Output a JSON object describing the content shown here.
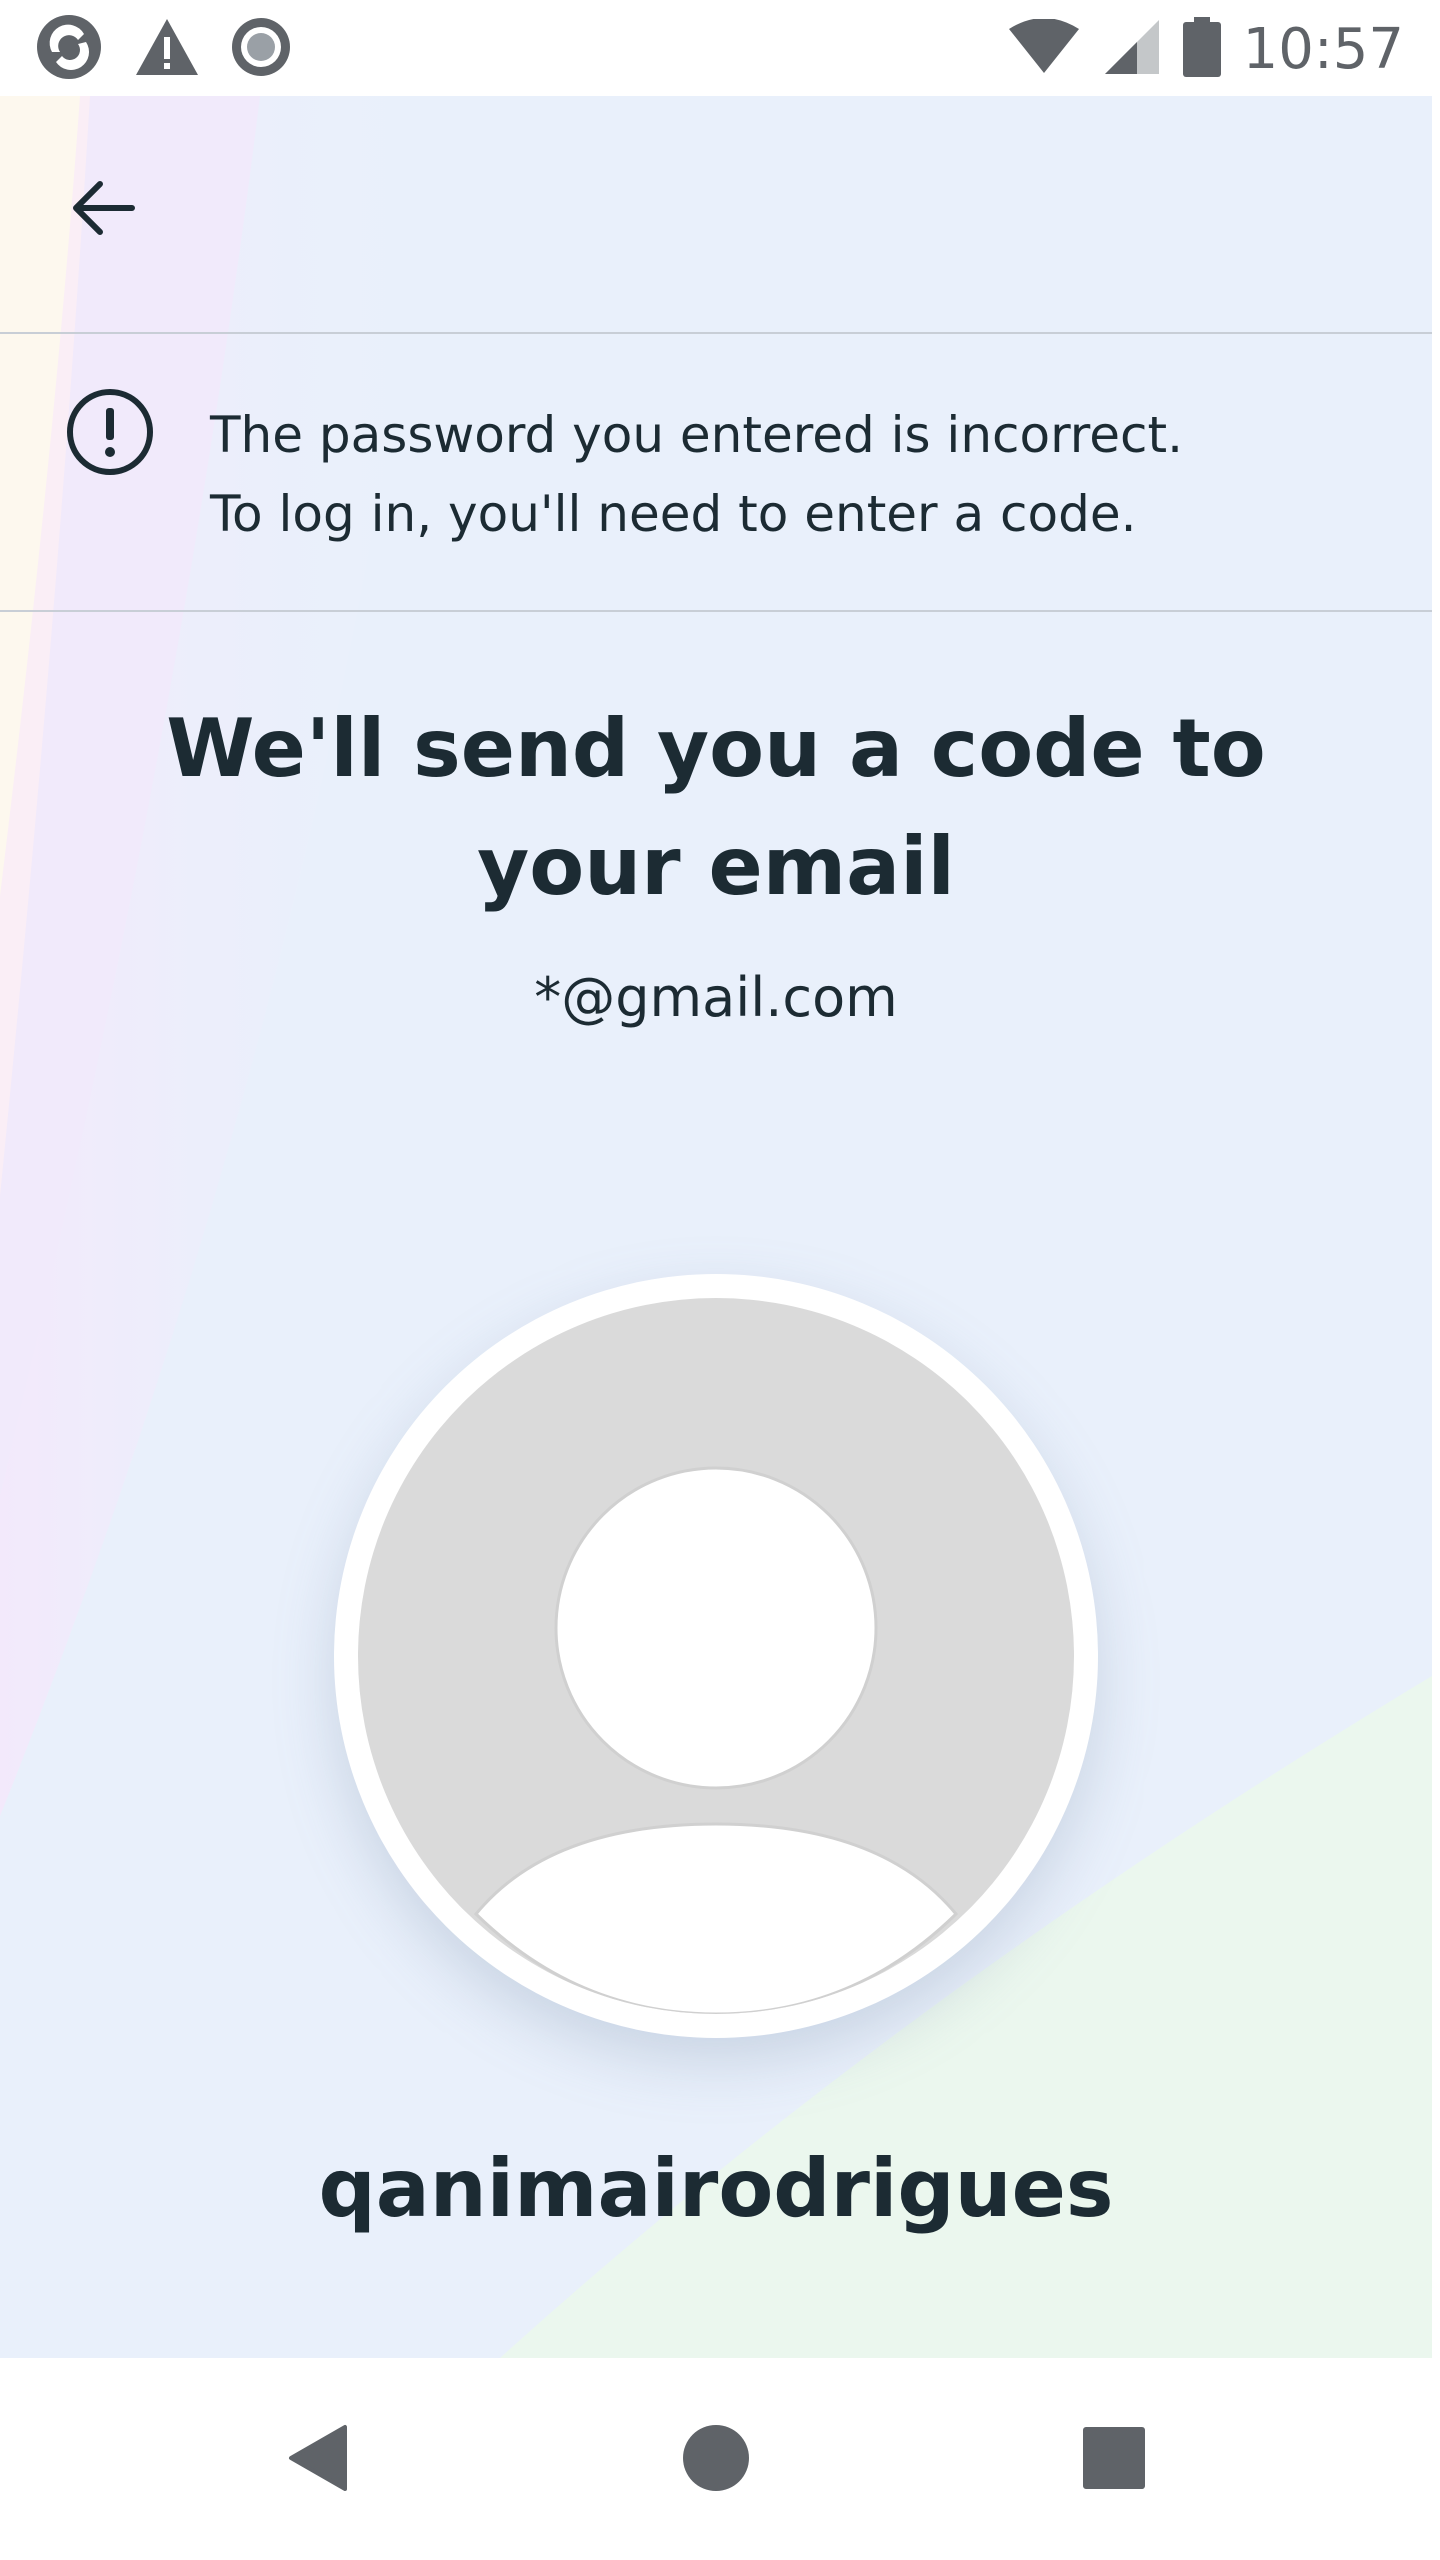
{
  "status_bar": {
    "time": "10:57",
    "left_icons": [
      "sync-app-icon",
      "warning-icon",
      "record-icon"
    ],
    "right_icons": [
      "wifi-icon",
      "cell-signal-icon",
      "battery-icon"
    ]
  },
  "header": {
    "back_icon": "arrow-left-icon"
  },
  "alert": {
    "icon": "exclamation-circle-icon",
    "line1": "The password you entered is incorrect.",
    "line2": "To log in, you'll need to enter a code."
  },
  "main": {
    "heading_line1": "We'll send you a code to",
    "heading_line2": "your email",
    "email": "*@gmail.com",
    "avatar_icon": "default-avatar-icon",
    "username": "qanimairodrigues"
  },
  "nav_bar": {
    "back_icon": "nav-back-icon",
    "home_icon": "nav-home-icon",
    "recents_icon": "nav-recents-icon"
  },
  "colors": {
    "text": "#1c2b33",
    "background": "#e9f0fb",
    "divider": "#c8ced6",
    "avatar_fill": "#dadada",
    "nav_icons": "#5f6368"
  }
}
